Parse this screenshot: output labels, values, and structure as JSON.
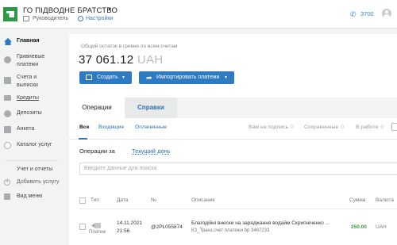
{
  "header": {
    "org_name": "ГО ПІДВОДНЕ БРАТСТВО",
    "role": "Руководитель",
    "settings": "Настройки",
    "phone": "3700"
  },
  "sidebar": {
    "items": [
      {
        "label": "Главная",
        "icon": "home-icon"
      },
      {
        "label": "Гривневые платежи",
        "icon": "hryvnia-icon"
      },
      {
        "label": "Счета и выписки",
        "icon": "accounts-icon"
      },
      {
        "label": "Кредиты",
        "icon": "credit-icon"
      },
      {
        "label": "Депозиты",
        "icon": "deposit-icon"
      },
      {
        "label": "Анкета",
        "icon": "questionnaire-icon"
      },
      {
        "label": "Каталог услуг",
        "icon": "catalog-icon"
      }
    ],
    "extra": {
      "reports": "Учет и отчеты",
      "add_service": "Добавить услугу",
      "view_menu": "Вид меню"
    }
  },
  "main": {
    "balance_label": "Общий остаток в гривне по всем счетам",
    "balance_amount": "37 061.12",
    "balance_currency": "UAH",
    "create_button": "Создать",
    "import_button": "Импортировать платежи",
    "tabs": [
      "Операции",
      "Справки"
    ],
    "filters": {
      "all": "Все",
      "incoming": "Входящие",
      "paid": "Оплаченные",
      "for_signature": "Вам на подпись",
      "for_signature_count": "0",
      "saved": "Сохраненные",
      "saved_count": "0",
      "in_progress": "В работе",
      "in_progress_count": "0"
    },
    "ops_for_label": "Операции за",
    "ops_period": "Текущий день",
    "search_placeholder": "Введите данные для поиска",
    "columns": [
      "Тип",
      "Дата",
      "№",
      "Описание",
      "Сумма",
      "Валюта"
    ],
    "rows": [
      {
        "type": "Платеж",
        "date": "14.11.2021",
        "time": "21:56",
        "number": "@2PL055874",
        "description": "Благодійні внески на заряджання водайм Скрипніченко ...",
        "subdescription": "КЗ_Транз.счет платежи bp 3467233",
        "amount": "250.00",
        "currency": "UAH"
      }
    ]
  },
  "colors": {
    "accent": "#2e7bc4",
    "logo": "#2a9a46",
    "amount": "#3e9b3a"
  }
}
